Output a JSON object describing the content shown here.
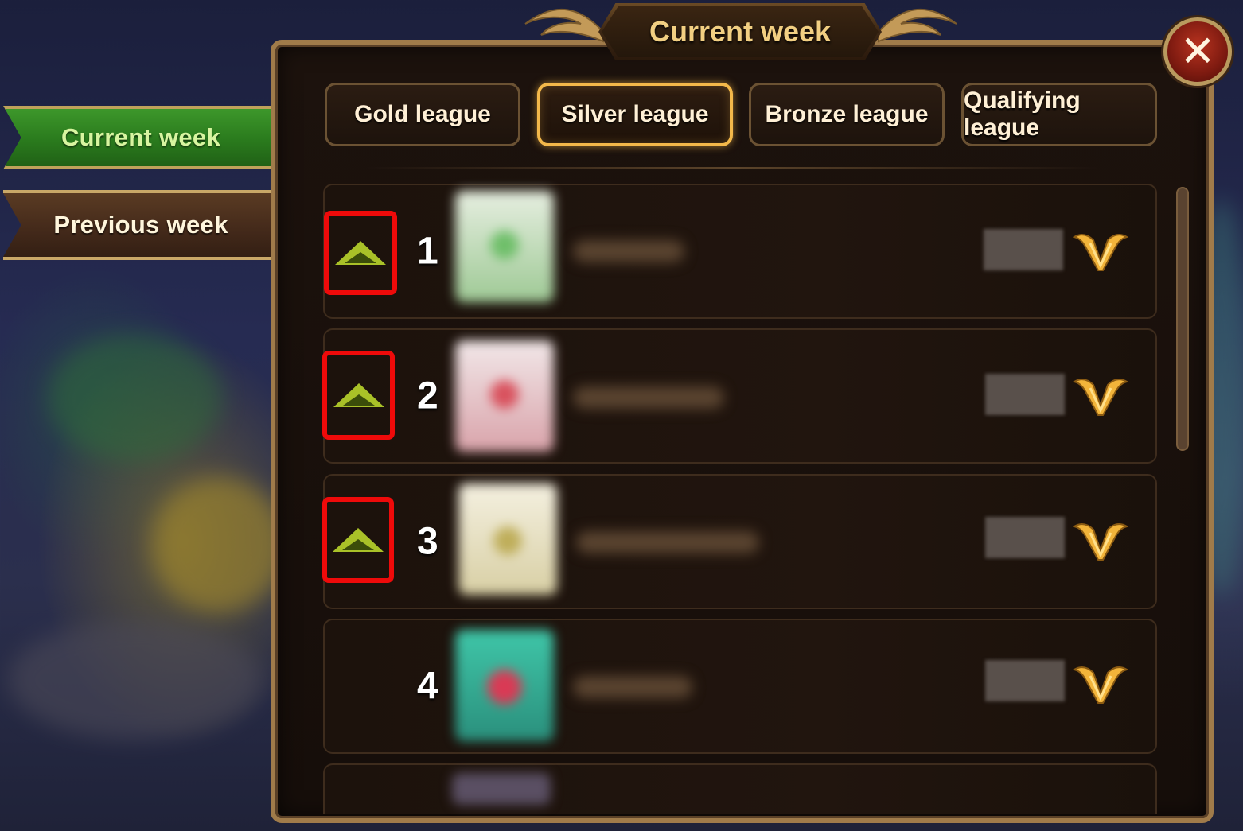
{
  "header": {
    "title": "Current week",
    "close_icon": "close-icon"
  },
  "side_tabs": [
    {
      "label": "Current week",
      "active": true
    },
    {
      "label": "Previous week",
      "active": false
    }
  ],
  "league_tabs": [
    {
      "label": "Gold league",
      "active": false
    },
    {
      "label": "Silver league",
      "active": true
    },
    {
      "label": "Bronze league",
      "active": false
    },
    {
      "label": "Qualifying league",
      "active": false
    }
  ],
  "rows": [
    {
      "rank": "1",
      "promotion_icon": "up-arrow-icon",
      "emblem_color": "#6fbf6a",
      "badge_icon": "v-badge-icon"
    },
    {
      "rank": "2",
      "promotion_icon": "up-arrow-icon",
      "emblem_color": "#d9525e",
      "badge_icon": "v-badge-icon"
    },
    {
      "rank": "3",
      "promotion_icon": "up-arrow-icon",
      "emblem_color": "#d8cf9a",
      "badge_icon": "v-badge-icon"
    },
    {
      "rank": "4",
      "promotion_icon": "",
      "emblem_color": "#3ab39a",
      "badge_icon": "v-badge-icon"
    }
  ],
  "colors": {
    "active_tab_border": "#f3b84a",
    "highlight_box": "#ee0a0a",
    "title_gold": "#f2cf82",
    "current_week_green": "#2a7a1d"
  }
}
